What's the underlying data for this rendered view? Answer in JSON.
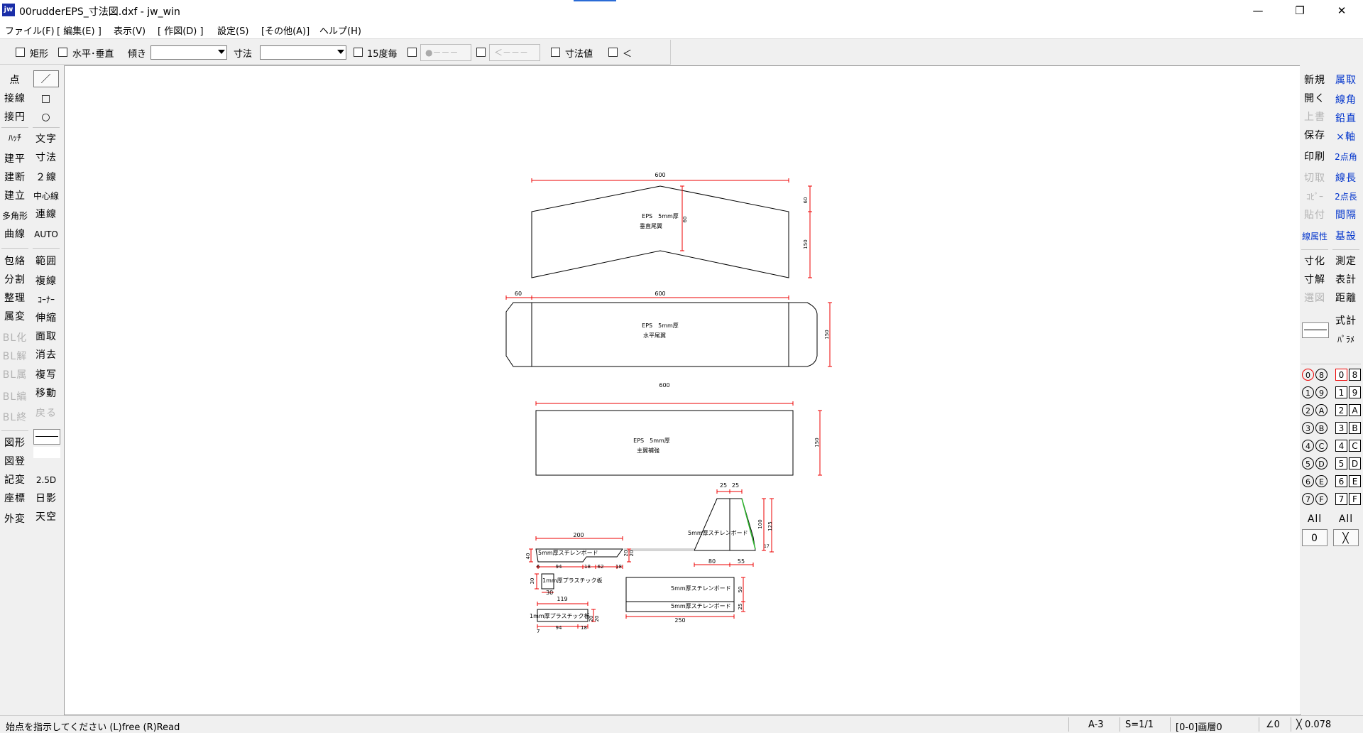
{
  "window": {
    "title": "00rudderEPS_寸法図.dxf - jw_win",
    "app_icon": "jw",
    "minimize": "—",
    "restore": "❐",
    "close": "✕"
  },
  "menu": [
    "ファイル(F)",
    "[ 編集(E) ]",
    "表示(V)",
    "[ 作図(D) ]",
    "設定(S)",
    "[その他(A)]",
    "ヘルプ(H)"
  ],
  "toolbar": {
    "rect": "矩形",
    "horiz_vert": "水平･垂直",
    "tilt": "傾き",
    "tilt_value": "",
    "dim": "寸法",
    "dim_value": "",
    "every15": "15度毎",
    "btn_circle": "●－－－",
    "btn_arrow": "＜－－－",
    "dim_value_label": "寸法値",
    "lt": "＜"
  },
  "left_tools": {
    "col1": [
      "点",
      "接線",
      "接円",
      "ﾊｯﾁ",
      "建平",
      "建断",
      "建立",
      "多角形",
      "曲線",
      "包絡",
      "分割",
      "整理",
      "属変",
      "BL化",
      "BL解",
      "BL属",
      "BL編",
      "BL終",
      "図形",
      "図登",
      "記変",
      "座標",
      "外変"
    ],
    "col2": [
      "／",
      "□",
      "○",
      "文字",
      "寸法",
      "２線",
      "中心線",
      "連線",
      "AUTO",
      "範囲",
      "複線",
      "ｺｰﾅｰ",
      "伸縮",
      "面取",
      "消去",
      "複写",
      "移動",
      "戻る",
      "",
      "2.5D",
      "日影",
      "天空"
    ]
  },
  "right_tools": {
    "col1": [
      "新規",
      "開く",
      "上書",
      "保存",
      "印刷",
      "切取",
      "ｺﾋﾟｰ",
      "貼付",
      "線属性",
      "寸化",
      "寸解",
      "選図",
      "",
      ""
    ],
    "col2": [
      "属取",
      "線角",
      "鉛直",
      "×軸",
      "2点角",
      "線長",
      "2点長",
      "間隔",
      "基設",
      "測定",
      "表計",
      "距離",
      "式計",
      "ﾊﾟﾗﾒ"
    ],
    "layer_groups": [
      "0",
      "8",
      "1",
      "9",
      "2",
      "A",
      "3",
      "B",
      "4",
      "C",
      "5",
      "D",
      "6",
      "E",
      "7",
      "F"
    ],
    "all_label": "All",
    "zero_label": "0",
    "x_label": "╳"
  },
  "drawing": {
    "part1": {
      "label1": "EPS　5mm厚",
      "label2": "垂直尾翼",
      "dim_width": "600",
      "dim_h1": "60",
      "dim_h2": "150",
      "dim_mid": "60"
    },
    "part2": {
      "label1": "EPS　5mm厚",
      "label2": "水平尾翼",
      "dim_left": "60",
      "dim_width": "600",
      "dim_height": "150"
    },
    "part3": {
      "label1": "EPS　5mm厚",
      "label2": "主翼補強",
      "dim_width": "600",
      "dim_height": "150"
    },
    "part4": {
      "label": "5mm厚スチレンボード",
      "dim_a": "25",
      "dim_b": "25",
      "dim_c": "100",
      "dim_d": "125",
      "dim_e": "80",
      "dim_f": "55",
      "dim_g": "17"
    },
    "part5": {
      "label": "5mm厚スチレンボード",
      "dim_top": "200",
      "dim_left": "40",
      "dim_b1": "94",
      "dim_b2": "18",
      "dim_b3": "62",
      "dim_b4": "18",
      "dim_r1": "20",
      "dim_r2": "20",
      "dim_b0": "6"
    },
    "part6": {
      "label": "1mm厚プラスチック板",
      "dim_h": "30",
      "dim_w": "30"
    },
    "part7": {
      "label": "1mm厚プラスチック板",
      "dim_top": "119",
      "dim_b1": "94",
      "dim_b2": "18",
      "dim_r1": "20",
      "dim_r2": "20",
      "dim_b0": "7"
    },
    "part8": {
      "label1": "5mm厚スチレンボード",
      "label2": "5mm厚スチレンボード",
      "dim_w": "250",
      "dim_h1": "50",
      "dim_h2": "25"
    }
  },
  "status": {
    "message": "始点を指示してください (L)free (R)Read",
    "paper": "A-3",
    "scale": "S=1/1",
    "layer": "[0-0]画層0",
    "angle": "∠0",
    "zoom": "╳ 0.078"
  }
}
